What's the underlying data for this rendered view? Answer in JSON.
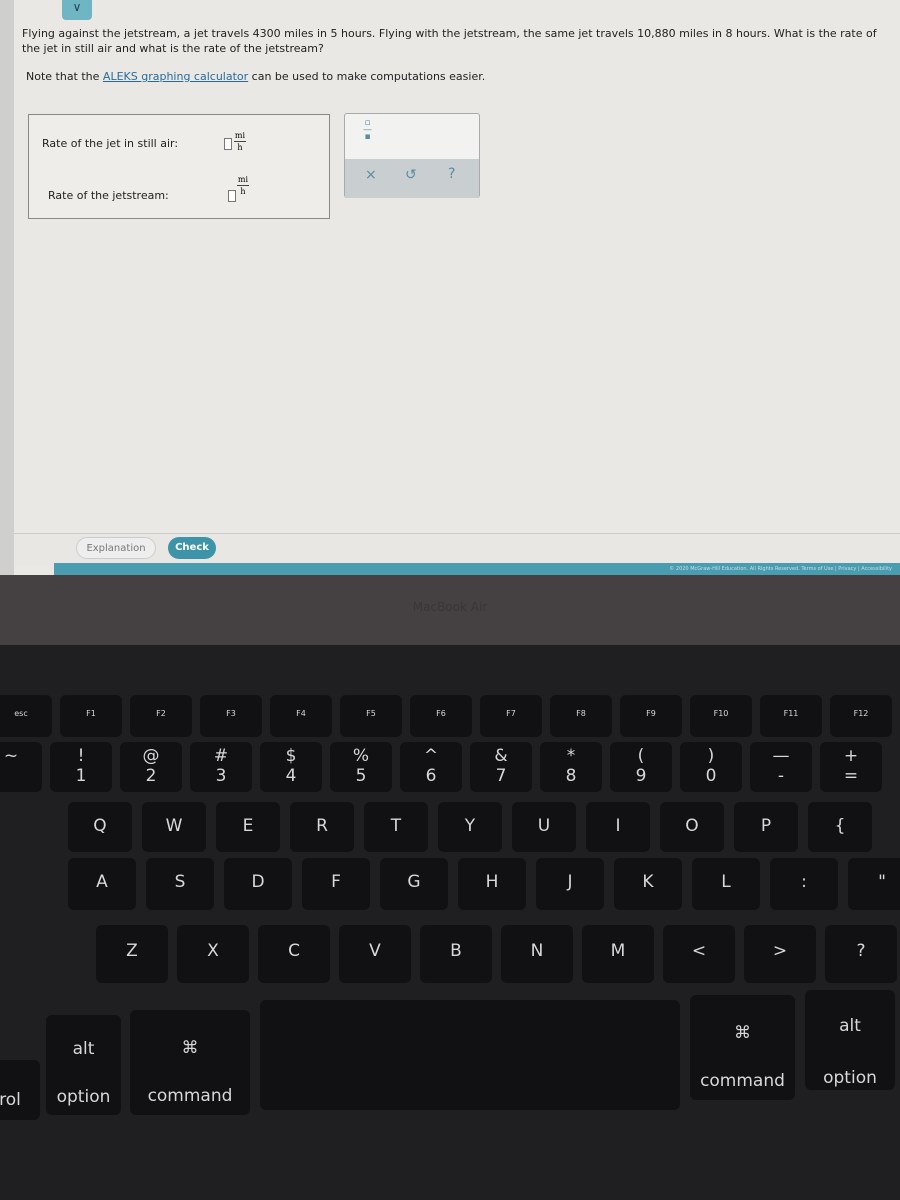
{
  "question": {
    "text": "Flying against the jetstream, a jet travels 4300 miles in 5 hours. Flying with the jetstream, the same jet travels 10,880 miles in 8 hours. What is the rate of the jet in still air and what is the rate of the jetstream?",
    "note_prefix": "Note that the ",
    "note_link": "ALEKS graphing calculator",
    "note_suffix": " can be used to make computations easier."
  },
  "answers": [
    {
      "label": "Rate of the jet in still air:",
      "value": "",
      "unit_num": "mi",
      "unit_den": "h"
    },
    {
      "label": "Rate of the jetstream:",
      "value": "",
      "unit_num": "mi",
      "unit_den": "h"
    }
  ],
  "tools": {
    "fraction": "fraction-icon",
    "clear": "×",
    "undo": "↺",
    "help": "?"
  },
  "toggle": "∨",
  "buttons": {
    "explanation": "Explanation",
    "check": "Check"
  },
  "footer": "© 2020 McGraw-Hill Education. All Rights Reserved.   Terms of Use  |  Privacy  |  Accessibility",
  "laptop_brand": "MacBook Air",
  "keyboard": {
    "fn_row": [
      "esc",
      "F1",
      "F2",
      "F3",
      "F4",
      "F5",
      "F6",
      "F7",
      "F8",
      "F9",
      "F10",
      "F11",
      "F12"
    ],
    "num_row": [
      [
        "~",
        ""
      ],
      [
        "!",
        "1"
      ],
      [
        "@",
        "2"
      ],
      [
        "#",
        "3"
      ],
      [
        "$",
        "4"
      ],
      [
        "%",
        "5"
      ],
      [
        "^",
        "6"
      ],
      [
        "&",
        "7"
      ],
      [
        "*",
        "8"
      ],
      [
        "(",
        "9"
      ],
      [
        ")",
        "0"
      ],
      [
        "—",
        "-"
      ],
      [
        "+",
        "="
      ]
    ],
    "row_q": [
      "Q",
      "W",
      "E",
      "R",
      "T",
      "Y",
      "U",
      "I",
      "O",
      "P",
      "{"
    ],
    "row_a": [
      "A",
      "S",
      "D",
      "F",
      "G",
      "H",
      "J",
      "K",
      "L",
      ":",
      "\""
    ],
    "row_z": [
      "Z",
      "X",
      "C",
      "V",
      "B",
      "N",
      "M",
      "<",
      ">",
      "?"
    ],
    "bottom": {
      "control": "rol",
      "alt_left": "alt",
      "option_left": "option",
      "cmd_symbol": "⌘",
      "command_left": "command",
      "command_right": "command",
      "alt_right": "alt",
      "option_right": "option"
    }
  },
  "colors": {
    "accent": "#3d93a8",
    "footer": "#4a9db0",
    "link": "#2a6a9a"
  }
}
